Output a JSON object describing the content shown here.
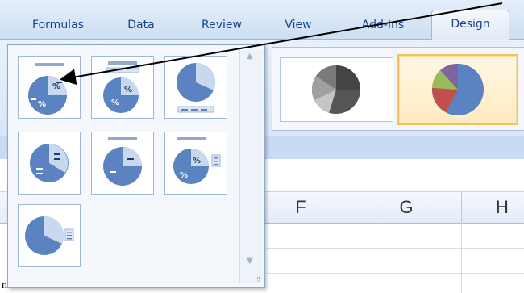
{
  "ribbon_tabs": [
    {
      "label": "Formulas"
    },
    {
      "label": "Data"
    },
    {
      "label": "Review"
    },
    {
      "label": "View"
    },
    {
      "label": "Add-Ins"
    },
    {
      "label": "Design",
      "active": true
    }
  ],
  "chart_layout_gallery": {
    "items": [
      {
        "icon": "pie-layout-1-icon"
      },
      {
        "icon": "pie-layout-2-icon"
      },
      {
        "icon": "pie-layout-3-icon"
      },
      {
        "icon": "pie-layout-4-icon"
      },
      {
        "icon": "pie-layout-5-icon"
      },
      {
        "icon": "pie-layout-6-icon"
      },
      {
        "icon": "pie-layout-7-icon"
      }
    ]
  },
  "chart_styles": [
    {
      "icon": "grayscale-pie-style-icon"
    },
    {
      "icon": "color-pie-style-icon",
      "selected": true
    }
  ],
  "columns": [
    "F",
    "G",
    "H"
  ],
  "cell_fragment": "nt",
  "colors": {
    "accent": "#15428b",
    "selection": "#f3c35a",
    "pie_blue": "#5b82c1"
  }
}
